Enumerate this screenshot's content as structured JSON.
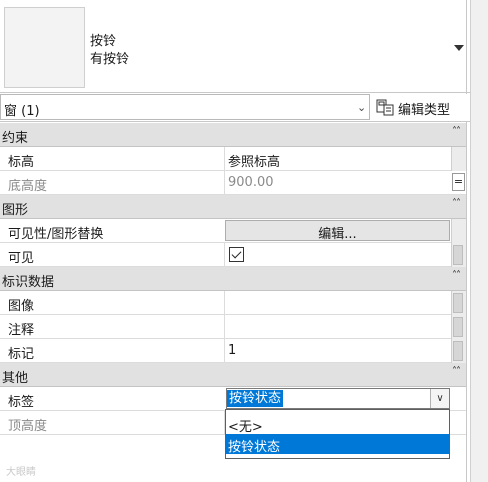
{
  "header": {
    "family_name": "按铃",
    "type_name": "有按铃"
  },
  "filter": {
    "label": "窗 (1)",
    "edit_type_label": "编辑类型"
  },
  "groups": {
    "constraints": "约束",
    "graphics": "图形",
    "identity": "标识数据",
    "other": "其他"
  },
  "properties": {
    "level": {
      "name": "标高",
      "value": "参照标高"
    },
    "sill_height": {
      "name": "底高度",
      "value": "900.00"
    },
    "vis_override": {
      "name": "可见性/图形替换",
      "value": "编辑..."
    },
    "visible": {
      "name": "可见",
      "checked": true
    },
    "image": {
      "name": "图像",
      "value": ""
    },
    "comments": {
      "name": "注释",
      "value": ""
    },
    "mark": {
      "name": "标记",
      "value": "1"
    },
    "label": {
      "name": "标签",
      "value": "按铃状态"
    },
    "head_height": {
      "name": "顶高度",
      "value": ""
    }
  },
  "dropdown": {
    "options": [
      "<无>",
      "按铃状态"
    ],
    "selected_index": 1
  },
  "footer": {
    "watermark": "大眼睛"
  },
  "colors": {
    "selection": "#0078d7",
    "group_bg": "#e1e1e1"
  },
  "icons": {
    "edit_type": "edit-type-icon",
    "filter_dropdown": "chevron-down-icon",
    "collapse": "collapse-chevrons-icon"
  }
}
